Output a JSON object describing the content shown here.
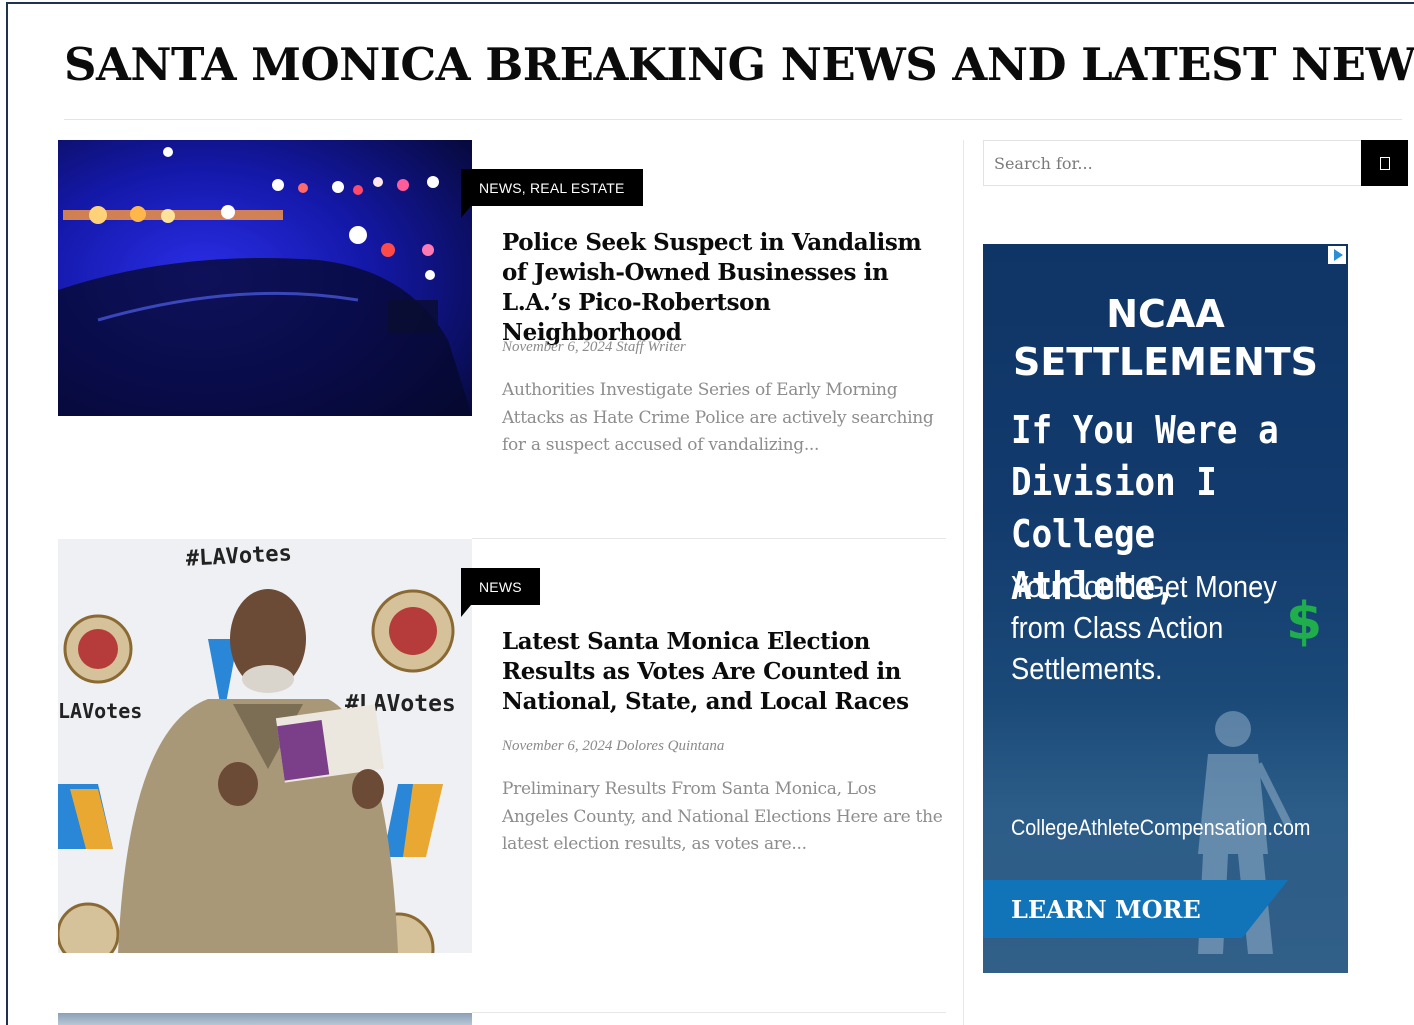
{
  "header": {
    "title": "SANTA MONICA BREAKING NEWS AND LATEST NEWS"
  },
  "search": {
    "placeholder": "Search for...",
    "button_icon": "search-icon"
  },
  "posts": [
    {
      "category": "NEWS, REAL ESTATE",
      "title": "Police Seek Suspect in Vandalism of Jewish-Owned Businesses in L.A.’s Pico-Robertson Neighborhood",
      "date": "November 6, 2024",
      "author": "Staff Writer",
      "excerpt": "Authorities Investigate Series of Early Morning Attacks as Hate Crime Police are actively searching for a suspect accused of vandalizing..."
    },
    {
      "category": "NEWS",
      "title": "Latest Santa Monica Election Results as Votes Are Counted in National, State, and Local Races",
      "date": "November 6, 2024",
      "author": "Dolores Quintana",
      "excerpt": "Preliminary Results From Santa Monica, Los Angeles County, and National Elections Here are the latest election results, as votes are..."
    }
  ],
  "post2_image_text": {
    "hashtag_top": "#LAVotes",
    "hashtag_right": "#LAVotes",
    "hashtag_left": "LAVotes"
  },
  "ad": {
    "heading": "NCAA SETTLEMENTS",
    "subheading": "If You Were a Division I College Athlete,",
    "body": "You Could Get Money from Class Action Settlements.",
    "dollar": "$",
    "url": "CollegeAthleteCompensation.com",
    "cta": "LEARN MORE",
    "colors": {
      "background": "#123a6c",
      "cta": "#1274b8",
      "dollar": "#1fae4b"
    }
  }
}
